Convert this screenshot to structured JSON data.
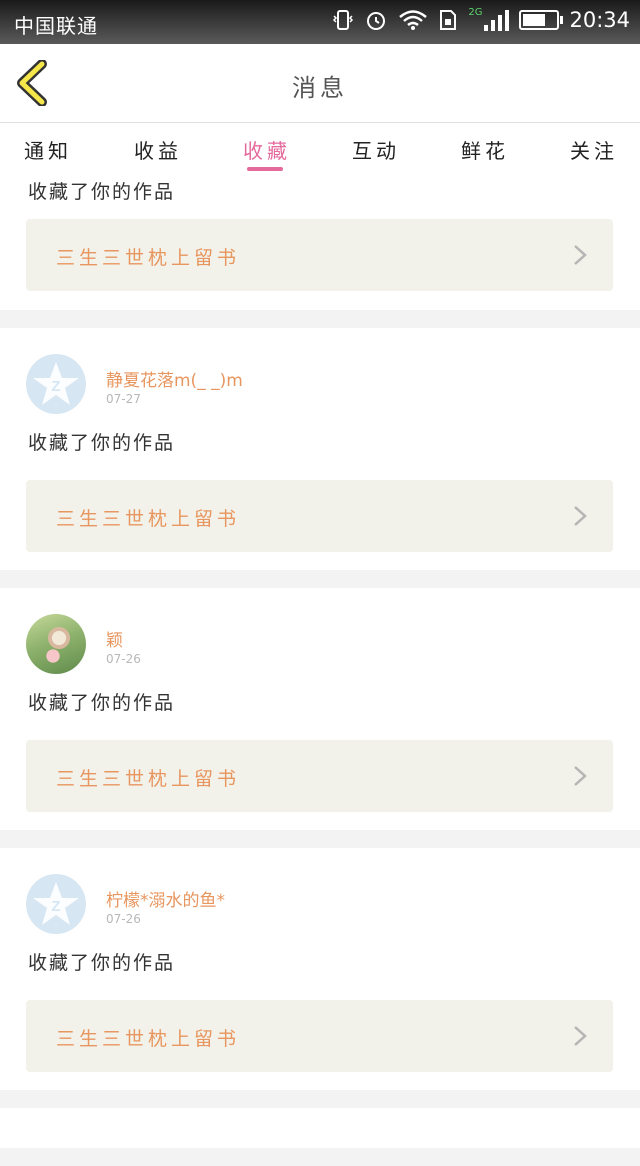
{
  "status_bar": {
    "carrier": "中国联通",
    "network_badge": "2G",
    "time": "20:34",
    "battery_level": 0.8,
    "icons": [
      "vibrate-icon",
      "alarm-icon",
      "wifi-icon",
      "sim-icon",
      "signal-icon",
      "battery-icon"
    ]
  },
  "header": {
    "title": "消息",
    "back_icon": "chevron-left-icon",
    "accent_color": "#f5e74a"
  },
  "tabs": [
    {
      "label": "通知",
      "active": false
    },
    {
      "label": "收益",
      "active": false
    },
    {
      "label": "收藏",
      "active": true
    },
    {
      "label": "互动",
      "active": false
    },
    {
      "label": "鲜花",
      "active": false
    },
    {
      "label": "关注",
      "active": false
    }
  ],
  "colors": {
    "active_tab": "#e46a9c",
    "username": "#e8965f",
    "work_bg": "#f2f2ea"
  },
  "items": [
    {
      "username": "",
      "date": "",
      "avatar": "",
      "action": "收藏了你的作品",
      "work_title": "三生三世枕上留书"
    },
    {
      "username": "静夏花落m(_ _)m",
      "date": "07-27",
      "avatar": "default-avatar-icon",
      "action": "收藏了你的作品",
      "work_title": "三生三世枕上留书"
    },
    {
      "username": "颖",
      "date": "07-26",
      "avatar": "photo-avatar",
      "action": "收藏了你的作品",
      "work_title": "三生三世枕上留书"
    },
    {
      "username": "柠檬*溺水的鱼*",
      "date": "07-26",
      "avatar": "default-avatar-icon",
      "action": "收藏了你的作品",
      "work_title": "三生三世枕上留书"
    }
  ]
}
